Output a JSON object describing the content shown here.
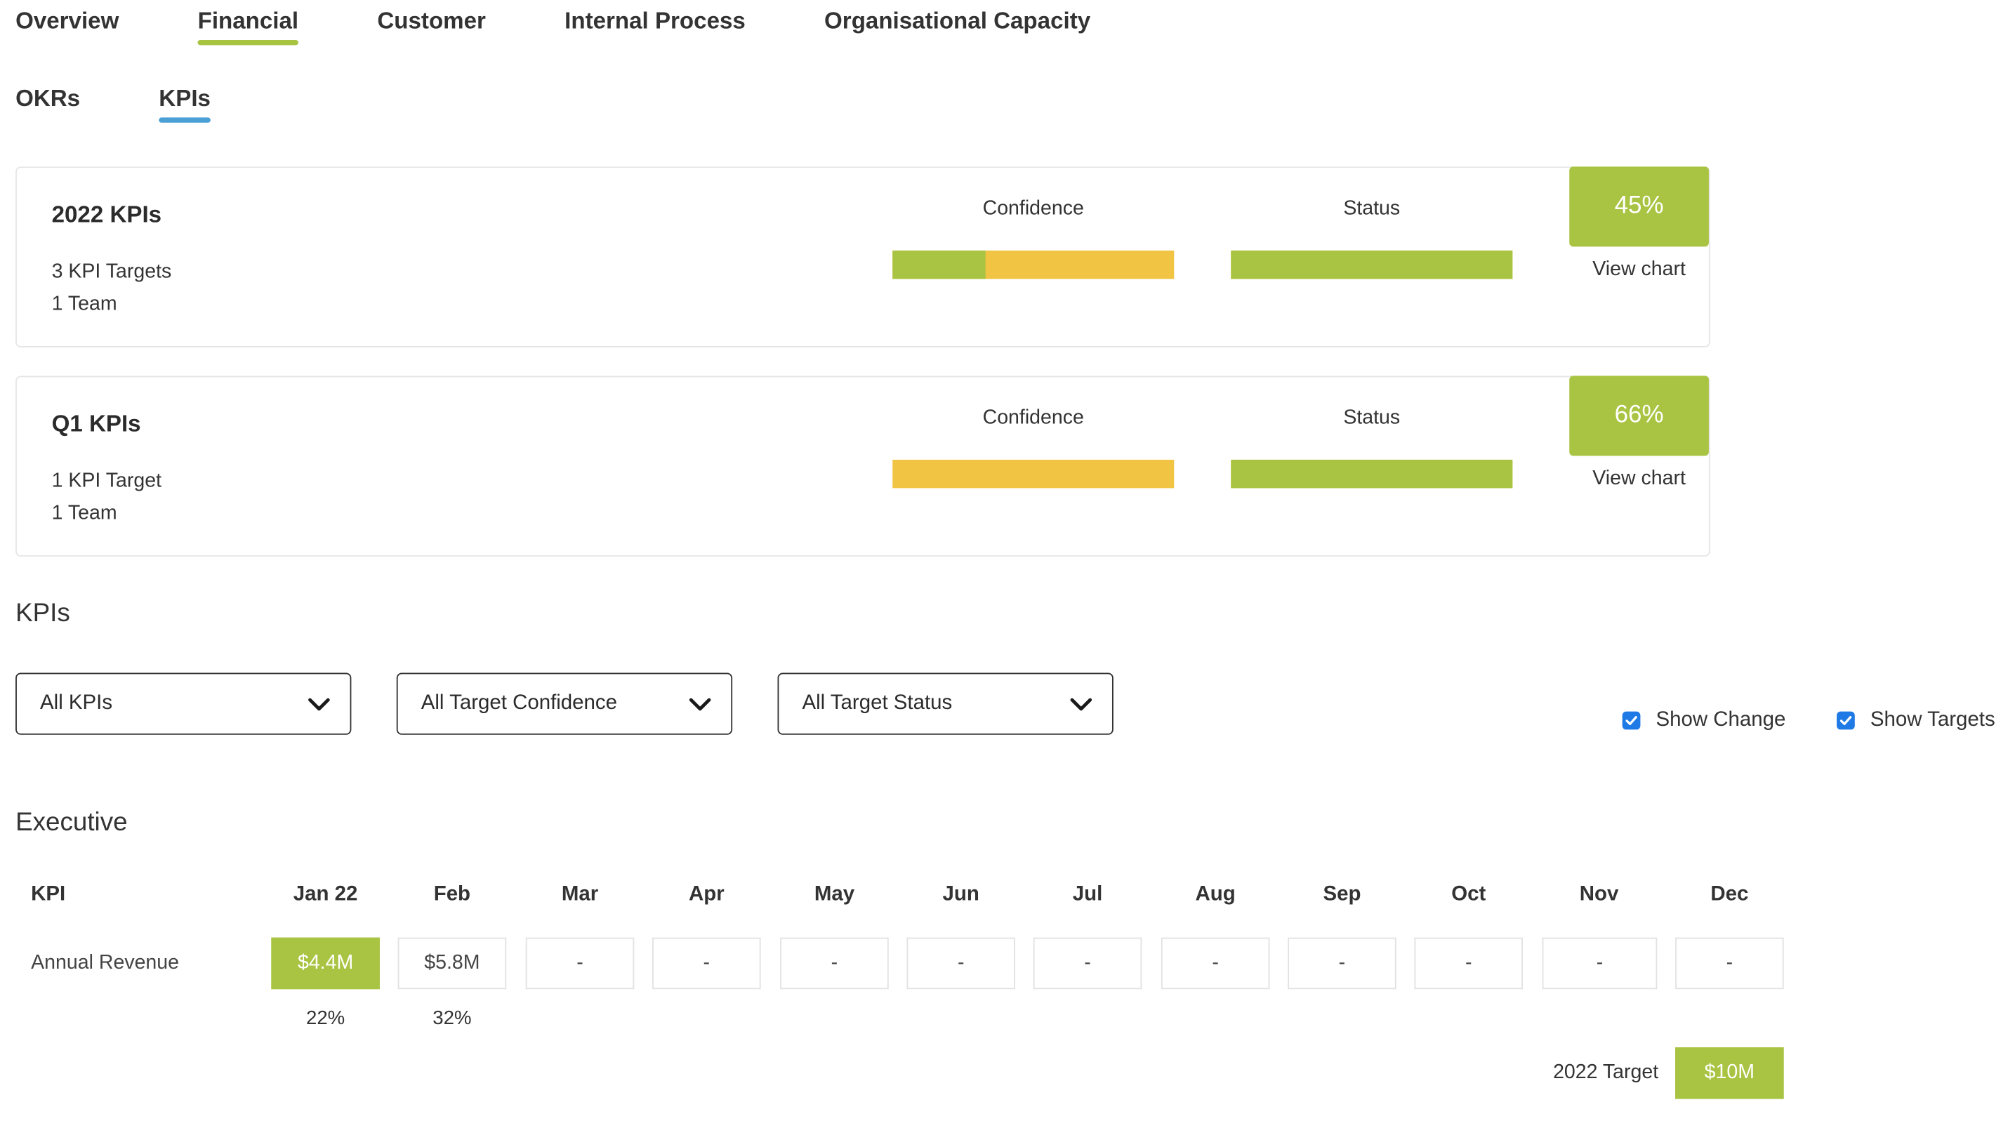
{
  "nav": {
    "tabs": [
      {
        "label": "Overview"
      },
      {
        "label": "Financial",
        "active": true
      },
      {
        "label": "Customer"
      },
      {
        "label": "Internal Process"
      },
      {
        "label": "Organisational Capacity"
      }
    ],
    "subtabs": [
      {
        "label": "OKRs"
      },
      {
        "label": "KPIs",
        "active": true
      }
    ]
  },
  "colors": {
    "green": "#a9c442",
    "yellow": "#f2c443",
    "blue_underline": "#4a9fd5",
    "checkbox": "#1f7ae6"
  },
  "cards": [
    {
      "title": "2022 KPIs",
      "line1": "3 KPI Targets",
      "line2": "1 Team",
      "confidence_label": "Confidence",
      "status_label": "Status",
      "confidence_green_fraction": 0.33,
      "status_green_fraction": 1.0,
      "percent": "45%",
      "view_chart": "View chart"
    },
    {
      "title": "Q1 KPIs",
      "line1": "1 KPI Target",
      "line2": "1 Team",
      "confidence_label": "Confidence",
      "status_label": "Status",
      "confidence_green_fraction": 0.0,
      "status_green_fraction": 1.0,
      "percent": "66%",
      "view_chart": "View chart"
    }
  ],
  "kpis_section": {
    "title": "KPIs",
    "filters": [
      {
        "value": "All KPIs"
      },
      {
        "value": "All Target Confidence"
      },
      {
        "value": "All Target Status"
      }
    ],
    "checkboxes": [
      {
        "label": "Show Change",
        "checked": true
      },
      {
        "label": "Show Targets",
        "checked": true
      }
    ]
  },
  "executive": {
    "title": "Executive",
    "kpi_header": "KPI",
    "months": [
      "Jan 22",
      "Feb",
      "Mar",
      "Apr",
      "May",
      "Jun",
      "Jul",
      "Aug",
      "Sep",
      "Oct",
      "Nov",
      "Dec"
    ],
    "row": {
      "name": "Annual Revenue",
      "values": [
        "$4.4M",
        "$5.8M",
        "-",
        "-",
        "-",
        "-",
        "-",
        "-",
        "-",
        "-",
        "-",
        "-"
      ],
      "highlight": [
        true,
        false,
        false,
        false,
        false,
        false,
        false,
        false,
        false,
        false,
        false,
        false
      ],
      "changes": [
        "22%",
        "32%"
      ]
    },
    "target_label": "2022 Target",
    "target_value": "$10M"
  }
}
